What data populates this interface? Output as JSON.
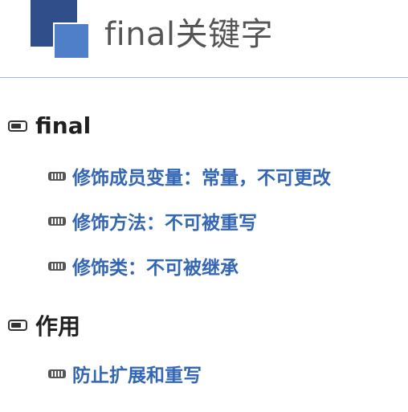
{
  "slide": {
    "title": "final关键字",
    "sections": [
      {
        "heading": "final",
        "items": [
          "修饰成员变量：常量，不可更改",
          "修饰方法：不可被重写",
          "修饰类：不可被继承"
        ]
      },
      {
        "heading": "作用",
        "items": [
          "防止扩展和重写"
        ]
      }
    ]
  },
  "colors": {
    "accent_dark": "#2f4e8a",
    "accent_light": "#4f7fc9",
    "subitem_text": "#3366b3",
    "heading_text": "#202020"
  },
  "icons": {
    "level1_bullet": "filled-box-bullet-icon",
    "level2_bullet": "striped-box-bullet-icon"
  }
}
